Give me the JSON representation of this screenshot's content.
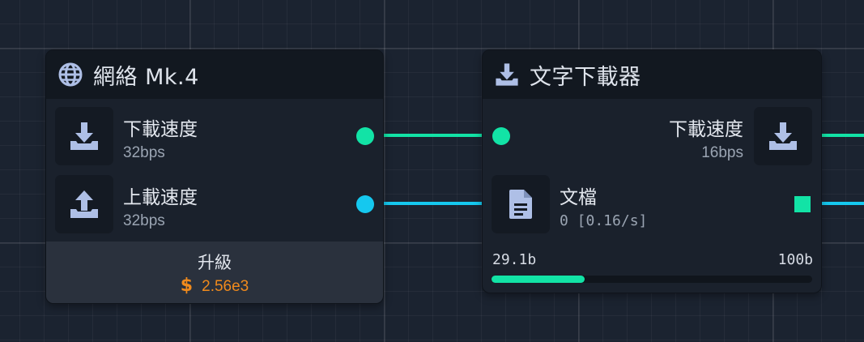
{
  "colors": {
    "download": "#12e3a6",
    "upload": "#15c8ef",
    "item": "#12e3a6",
    "cost": "#f08a1c",
    "icon": "#aebfe6"
  },
  "network_node": {
    "title": "網絡 Mk.4",
    "title_icon": "globe-icon",
    "rows": [
      {
        "label": "下載速度",
        "value": "32bps",
        "icon": "download-icon"
      },
      {
        "label": "上載速度",
        "value": "32bps",
        "icon": "upload-icon"
      }
    ],
    "upgrade": {
      "label": "升級",
      "currency_symbol": "$",
      "cost": "2.56e3"
    }
  },
  "downloader_node": {
    "title": "文字下載器",
    "title_icon": "download-icon",
    "input": {
      "label": "下載速度",
      "value": "16bps",
      "icon": "download-icon"
    },
    "output": {
      "label": "文檔",
      "value": "0 [0.16/s]",
      "icon": "document-icon"
    },
    "progress": {
      "current": "29.1b",
      "max": "100b",
      "fraction": 0.291
    }
  }
}
